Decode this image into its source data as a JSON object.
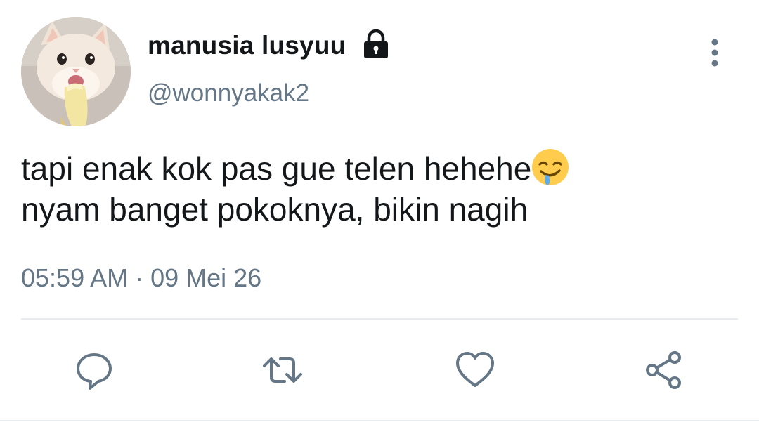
{
  "user": {
    "display_name": "manusia lusyuu",
    "handle": "@wonnyakak2",
    "avatar_icon": "cat-eating-banana-avatar",
    "protected_icon": "lock-icon"
  },
  "tweet": {
    "lines": [
      "tapi enak kok pas gue telen hehehe",
      "nyam banget pokoknya, bikin nagih"
    ],
    "emoji": "drooling-face-icon",
    "timestamp": "05:59 AM · 09 Mei 26"
  },
  "actions": [
    {
      "name": "reply",
      "icon": "reply-icon"
    },
    {
      "name": "retweet",
      "icon": "retweet-icon"
    },
    {
      "name": "like",
      "icon": "heart-icon"
    },
    {
      "name": "share",
      "icon": "share-icon"
    }
  ],
  "colors": {
    "text_primary": "#14171a",
    "text_secondary": "#657786",
    "icon_gray": "#657786",
    "divider": "#e6ecf0"
  }
}
